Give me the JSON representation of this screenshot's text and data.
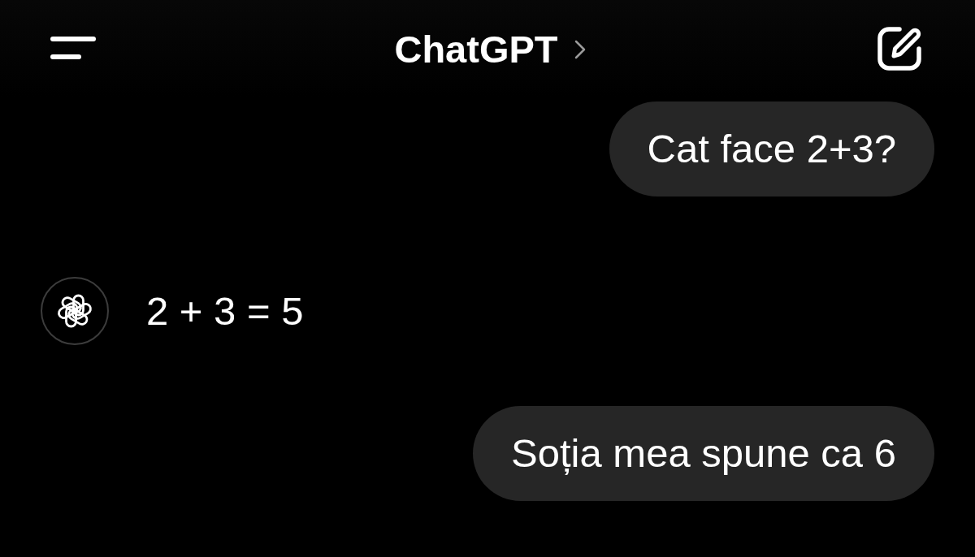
{
  "header": {
    "title": "ChatGPT"
  },
  "messages": [
    {
      "kind": "user",
      "text": "Cat face 2+3?"
    },
    {
      "kind": "assistant",
      "text": "2 + 3 = 5"
    },
    {
      "kind": "user",
      "text": "Soția mea spune ca 6"
    }
  ]
}
